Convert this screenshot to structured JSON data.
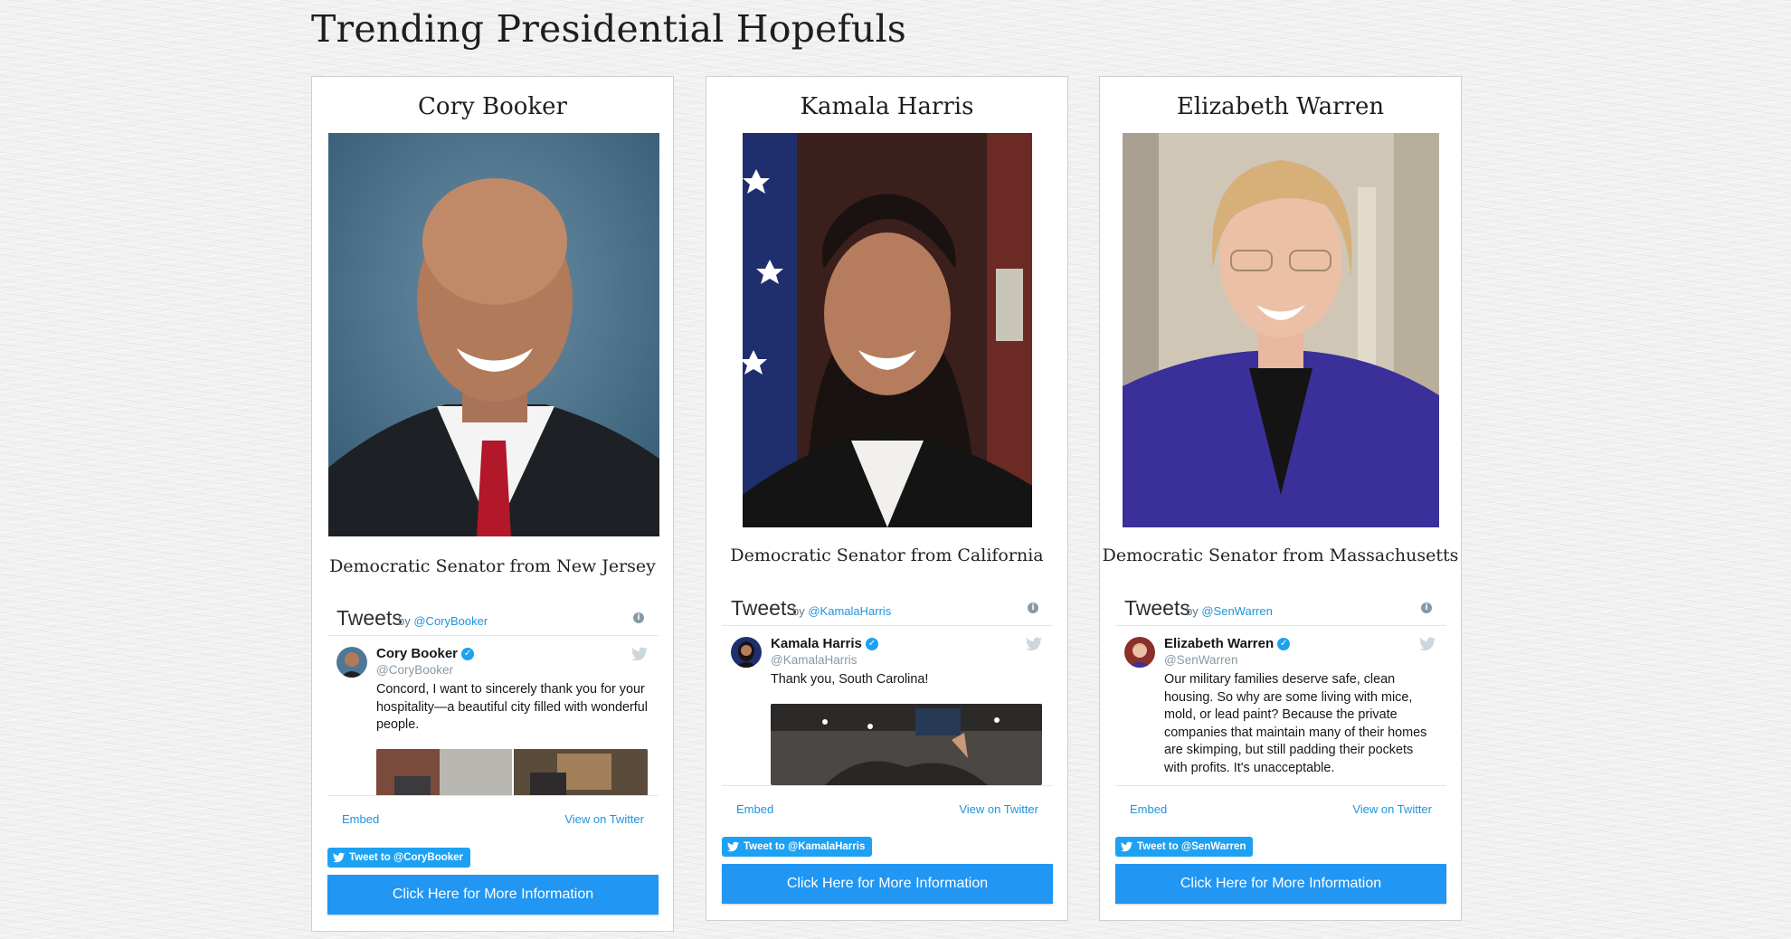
{
  "page": {
    "title": "Trending Presidential Hopefuls"
  },
  "cards": [
    {
      "name": "Cory Booker",
      "subtitle": "Democratic Senator from New Jersey",
      "timeline": {
        "title": "Tweets",
        "by": "by",
        "handle": "@CoryBooker",
        "tweet": {
          "author": "Cory Booker",
          "handle": "@CoryBooker",
          "text": "Concord, I want to sincerely thank you for your hospitality—a beautiful city filled with wonderful people."
        },
        "embed": "Embed",
        "view": "View on Twitter"
      },
      "tweet_button": "Tweet to @CoryBooker",
      "more_button": "Click Here for More Information"
    },
    {
      "name": "Kamala Harris",
      "subtitle": "Democratic Senator from California",
      "timeline": {
        "title": "Tweets",
        "by": "by",
        "handle": "@KamalaHarris",
        "tweet": {
          "author": "Kamala Harris",
          "handle": "@KamalaHarris",
          "text": "Thank you, South Carolina!"
        },
        "embed": "Embed",
        "view": "View on Twitter"
      },
      "tweet_button": "Tweet to @KamalaHarris",
      "more_button": "Click Here for More Information"
    },
    {
      "name": "Elizabeth Warren",
      "subtitle": "Democratic Senator from Massachusetts",
      "timeline": {
        "title": "Tweets",
        "by": "by",
        "handle": "@SenWarren",
        "tweet": {
          "author": "Elizabeth Warren",
          "handle": "@SenWarren",
          "text": "Our military families deserve safe, clean housing. So why are some living with mice, mold, or lead paint? Because the private companies that maintain many of their homes are skimping, but still padding their pockets with profits. It's unacceptable."
        },
        "embed": "Embed",
        "view": "View on Twitter"
      },
      "tweet_button": "Tweet to @SenWarren",
      "more_button": "Click Here for More Information"
    }
  ],
  "colors": {
    "twitter_blue": "#1da1f2",
    "button_blue": "#2196f3",
    "link_blue": "#1b95e0"
  },
  "icons": [
    "info-icon",
    "verified-icon",
    "twitter-bird-icon"
  ]
}
